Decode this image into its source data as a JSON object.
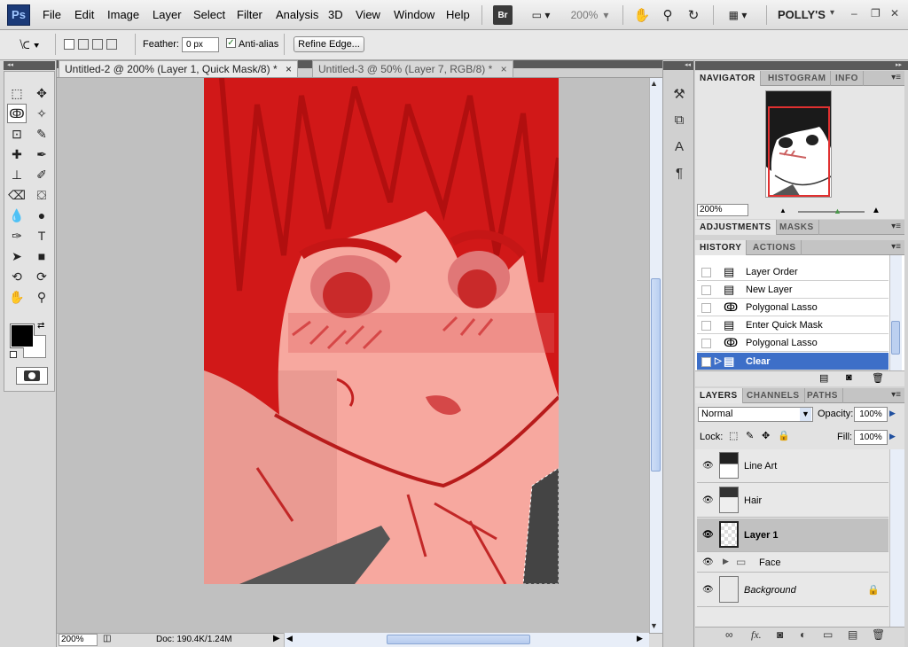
{
  "app": {
    "logo": "Ps"
  },
  "menu": [
    "File",
    "Edit",
    "Image",
    "Layer",
    "Select",
    "Filter",
    "Analysis",
    "3D",
    "View",
    "Window",
    "Help"
  ],
  "appbar": {
    "bridge": "Br",
    "zoom": "200%",
    "workspace": "POLLY'S"
  },
  "options": {
    "feather_label": "Feather:",
    "feather_value": "0 px",
    "antialias_label": "Anti-alias",
    "antialias_checked": true,
    "refine_edge": "Refine Edge..."
  },
  "tabs": [
    {
      "label": "Untitled-2 @ 200% (Layer 1, Quick Mask/8) *",
      "close": "×",
      "active": true
    },
    {
      "label": "Untitled-3 @ 50% (Layer 7, RGB/8) *",
      "close": "×",
      "active": false
    }
  ],
  "status": {
    "zoom": "200%",
    "doc": "Doc: 190.4K/1.24M"
  },
  "navigator": {
    "tabs": [
      "NAVIGATOR",
      "HISTOGRAM",
      "INFO"
    ],
    "zoom": "200%"
  },
  "adjustments": {
    "tabs": [
      "ADJUSTMENTS",
      "MASKS"
    ]
  },
  "history": {
    "tabs": [
      "HISTORY",
      "ACTIONS"
    ],
    "items": [
      {
        "label": "Layer Order",
        "icon": "doc-icon"
      },
      {
        "label": "New Layer",
        "icon": "doc-icon"
      },
      {
        "label": "Polygonal Lasso",
        "icon": "lasso-icon"
      },
      {
        "label": "Enter Quick Mask",
        "icon": "doc-icon"
      },
      {
        "label": "Polygonal Lasso",
        "icon": "lasso-icon"
      },
      {
        "label": "Clear",
        "icon": "doc-icon",
        "selected": true
      }
    ]
  },
  "layers": {
    "tabs": [
      "LAYERS",
      "CHANNELS",
      "PATHS"
    ],
    "blend_mode": "Normal",
    "opacity_label": "Opacity:",
    "opacity": "100%",
    "lock_label": "Lock:",
    "fill_label": "Fill:",
    "fill": "100%",
    "items": [
      {
        "name": "Line Art",
        "selected": false,
        "type": "layer"
      },
      {
        "name": "Hair",
        "selected": false,
        "type": "layer"
      },
      {
        "name": "Layer 1",
        "selected": true,
        "type": "layer"
      },
      {
        "name": "Face",
        "selected": false,
        "type": "group"
      },
      {
        "name": "Background",
        "selected": false,
        "type": "background"
      }
    ]
  },
  "colors": {
    "quick_mask": "#d41a1a",
    "selection_blue": "#3d6fc8",
    "panel": "#d3d3d3"
  }
}
